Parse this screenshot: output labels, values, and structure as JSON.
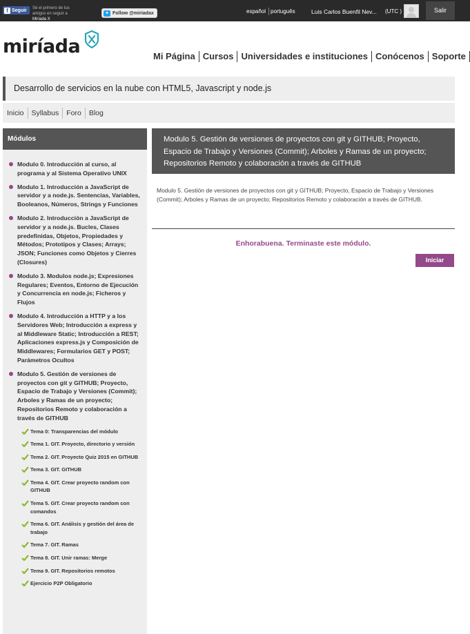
{
  "topbar": {
    "facebook_label": "Seguir",
    "facebook_text_prefix": "Sé el primero de tus amigos en seguir a ",
    "facebook_text_brand": "Miríada X",
    "twitter_label": "Follow @miriadax",
    "lang_es": "español",
    "lang_pt": "português",
    "user_name": "Luis Carlos Buenfil Nev...",
    "timezone": "(UTC )",
    "logout_label": "Salir"
  },
  "logo": {
    "text": "miríada"
  },
  "main_nav": [
    "Mi Página",
    "Cursos",
    "Universidades e instituciones",
    "Conócenos",
    "Soporte"
  ],
  "course": {
    "title": "Desarrollo de servicios en la nube con HTML5, Javascript y node.js"
  },
  "sub_nav": [
    "Inicio",
    "Syllabus",
    "Foro",
    "Blog"
  ],
  "sidebar": {
    "heading": "Módulos",
    "modules": [
      "Modulo 0. Introducción al curso, al programa y al Sistema Operativo UNIX",
      "Modulo 1. Introducción a JavaScript de servidor y a node.js. Sentencias, Variables, Booleanos, Números, Strings y Funciones",
      "Modulo 2. Introducción a JavaScript de servidor y a node.js. Bucles, Clases predefinidas, Objetos, Propiedades y Métodos; Prototipos y Clases; Arrays; JSON; Funciones como Objetos y Cierres (Closures)",
      "Modulo 3. Modulos node.js; Expresiones Regulares; Eventos, Entorno de Ejecución y Concurrencia en node.js; Ficheros y Flujos",
      "Modulo 4. Introducción a HTTP y a los Servidores Web; Introducción a express y al Middleware Static; Introducción a REST; Aplicaciones express.js y Composición de Middlewares; Formularios GET y POST; Parámetros Ocultos",
      "Modulo 5. Gestión de versiones de proyectos con git y GITHUB; Proyecto, Espacio de Trabajo y Versiones (Commit); Arboles y Ramas de un proyecto; Repositorios Remoto y colaboración a través de GITHUB"
    ],
    "temas": [
      "Tema 0: Transparencias del módulo",
      "Tema 1. GIT. Proyecto, directorio y versión",
      "Tema 2. GIT. Proyecto Quiz 2015 en GITHUB",
      "Tema 3. GIT. GITHUB",
      "Tema 4. GIT. Crear proyecto random con GITHUB",
      "Tema 5. GIT. Crear proyecto random con comandos",
      "Tema 6. GIT. Análisis y gestión del área de trabajo",
      "Tema 7. GIT. Ramas",
      "Tema 8. GIT. Unir ramas: Merge",
      "Tema 9. GIT. Repositorios remotos",
      "Ejercicio P2P Obligatorio"
    ]
  },
  "content": {
    "heading": "Modulo 5. Gestión de versiones de proyectos con git y GITHUB; Proyecto, Espacio de Trabajo y Versiones (Commit); Arboles y Ramas de un proyecto; Repositorios Remoto y colaboración a través de GITHUB",
    "description": "Modulo 5. Gestión de versiones de proyectos con git y GITHUB; Proyecto, Espacio de Trabajo y Versiones (Commit); Arboles y Ramas de un proyecto; Repositorios Remoto y colaboración a través de GITHUB.",
    "congrats": "Enhorabuena. Terminaste este módulo.",
    "start_button": "Iniciar"
  },
  "colors": {
    "accent": "#93498a",
    "check": "#8cb82b",
    "logo_badge": "#29a6b8",
    "topbar": "#2a2a2a"
  }
}
